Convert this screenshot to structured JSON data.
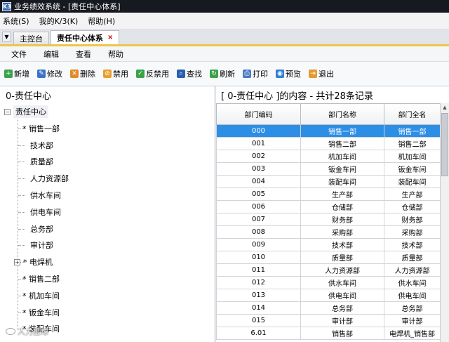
{
  "window": {
    "title": "业务绩效系统 - [责任中心体系]",
    "icon_text": "K3"
  },
  "menubar": [
    {
      "label": "系统(S)"
    },
    {
      "label": "我的K/3(K)"
    },
    {
      "label": "帮助(H)"
    }
  ],
  "tabs": [
    {
      "label": "主控台"
    },
    {
      "label": "责任中心体系",
      "close": "×"
    }
  ],
  "submenu": [
    {
      "label": "文件"
    },
    {
      "label": "编辑"
    },
    {
      "label": "查看"
    },
    {
      "label": "帮助"
    }
  ],
  "toolbar": [
    {
      "label": "新增",
      "icon": "add-icon",
      "color": "#3aa34a",
      "glyph": "+"
    },
    {
      "label": "修改",
      "icon": "edit-icon",
      "color": "#3b73c8",
      "glyph": "✎"
    },
    {
      "label": "删除",
      "icon": "delete-icon",
      "color": "#e08a2a",
      "glyph": "✕"
    },
    {
      "label": "禁用",
      "icon": "disable-icon",
      "color": "#e6a030",
      "glyph": "⊘"
    },
    {
      "label": "反禁用",
      "icon": "enable-icon",
      "color": "#3aa34a",
      "glyph": "✓"
    },
    {
      "label": "查找",
      "icon": "binoculars-icon",
      "color": "#2a5fb0",
      "glyph": "⌕"
    },
    {
      "label": "刷新",
      "icon": "refresh-icon",
      "color": "#3aa34a",
      "glyph": "↻"
    },
    {
      "label": "打印",
      "icon": "print-icon",
      "color": "#4a7cc4",
      "glyph": "⎙"
    },
    {
      "label": "预览",
      "icon": "preview-icon",
      "color": "#2f7fd6",
      "glyph": "◉"
    },
    {
      "label": "退出",
      "icon": "exit-icon",
      "color": "#e59a2e",
      "glyph": "⇥"
    }
  ],
  "tree": {
    "header": "0-责任中心",
    "root": {
      "label": "责任中心",
      "toggle": "−"
    },
    "items": [
      {
        "label": "* 销售一部",
        "toggle": null
      },
      {
        "label": "技术部",
        "toggle": null
      },
      {
        "label": "质量部",
        "toggle": null
      },
      {
        "label": "人力资源部",
        "toggle": null
      },
      {
        "label": "供水车间",
        "toggle": null
      },
      {
        "label": "供电车间",
        "toggle": null
      },
      {
        "label": "总务部",
        "toggle": null
      },
      {
        "label": "审计部",
        "toggle": null
      },
      {
        "label": "* 电焊机",
        "toggle": "+"
      },
      {
        "label": "* 销售二部",
        "toggle": null
      },
      {
        "label": "* 机加车间",
        "toggle": null
      },
      {
        "label": "* 钣金车间",
        "toggle": null
      },
      {
        "label": "* 装配车间",
        "toggle": null
      }
    ]
  },
  "grid": {
    "header": "[ 0-责任中心 ]的内容 - 共计28条记录",
    "columns": [
      "部门编码",
      "部门名称",
      "部门全名"
    ],
    "rows": [
      [
        "000",
        "销售一部",
        "销售一部"
      ],
      [
        "001",
        "销售二部",
        "销售二部"
      ],
      [
        "002",
        "机加车间",
        "机加车间"
      ],
      [
        "003",
        "钣金车间",
        "钣金车间"
      ],
      [
        "004",
        "装配车间",
        "装配车间"
      ],
      [
        "005",
        "生产部",
        "生产部"
      ],
      [
        "006",
        "仓储部",
        "仓储部"
      ],
      [
        "007",
        "财务部",
        "财务部"
      ],
      [
        "008",
        "采购部",
        "采购部"
      ],
      [
        "009",
        "技术部",
        "技术部"
      ],
      [
        "010",
        "质量部",
        "质量部"
      ],
      [
        "011",
        "人力资源部",
        "人力资源部"
      ],
      [
        "012",
        "供水车间",
        "供水车间"
      ],
      [
        "013",
        "供电车间",
        "供电车间"
      ],
      [
        "014",
        "总务部",
        "总务部"
      ],
      [
        "015",
        "审计部",
        "审计部"
      ],
      [
        "6.01",
        "销售部",
        "电焊机_销售部"
      ]
    ],
    "selected_row": 0
  },
  "watermark": "人力星球"
}
